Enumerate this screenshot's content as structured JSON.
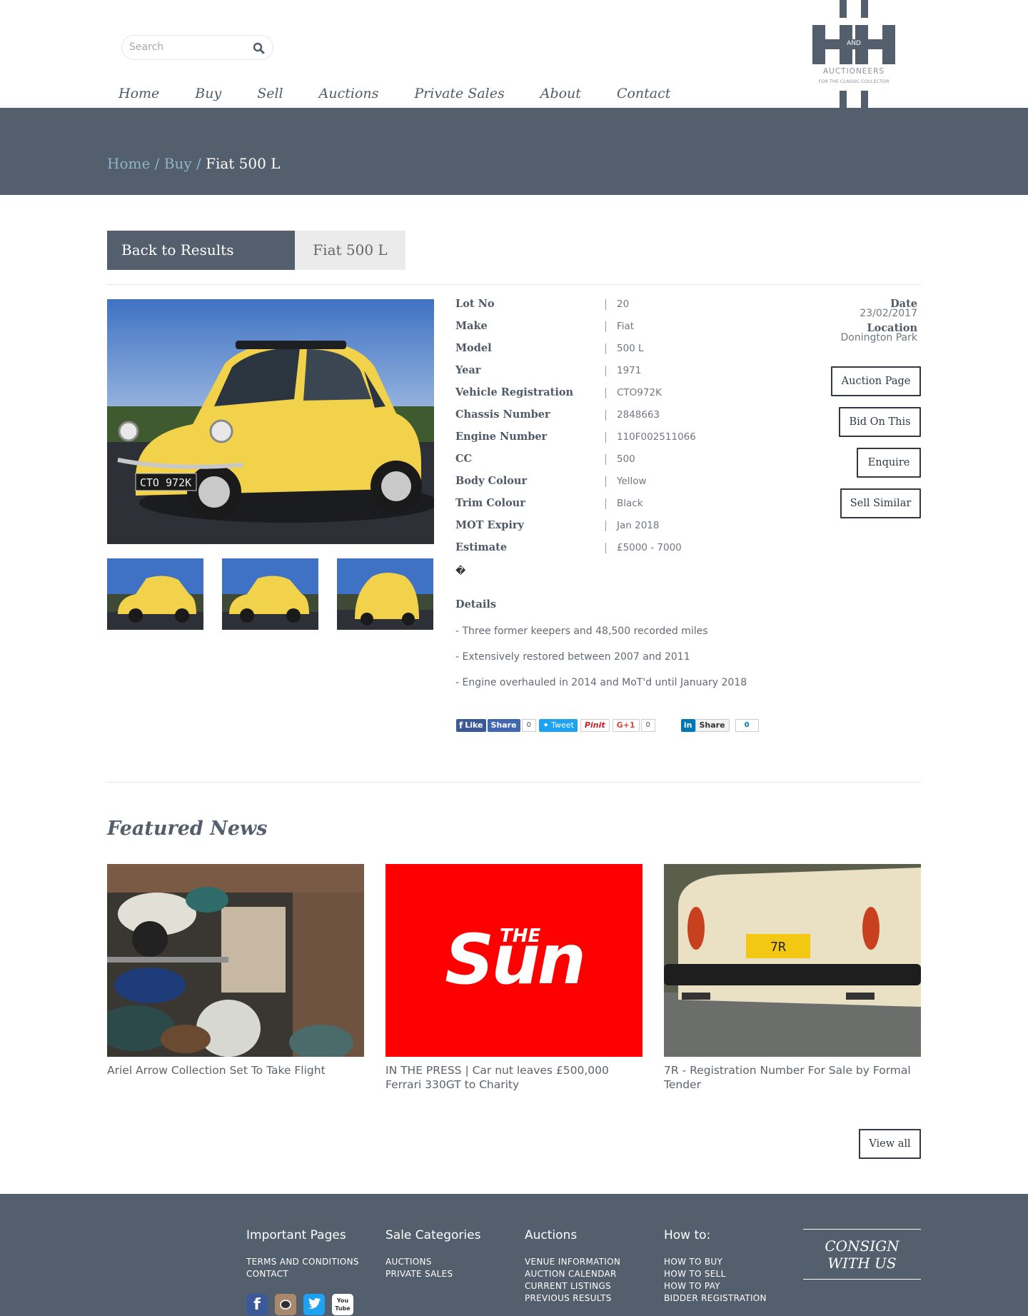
{
  "header": {
    "search_placeholder": "Search",
    "logo_and": "AND",
    "logo_line1": "AUCTIONEERS",
    "logo_line2": "FOR THE CLASSIC COLLECTOR",
    "nav": [
      "Home",
      "Buy",
      "Sell",
      "Auctions",
      "Private Sales",
      "About",
      "Contact"
    ]
  },
  "breadcrumb": {
    "home": "Home",
    "sep1": " / ",
    "buy": "Buy",
    "sep2": " / ",
    "current": "Fiat 500 L"
  },
  "tabs": {
    "back": "Back to Results",
    "current": "Fiat 500 L"
  },
  "specs": [
    {
      "label": "Lot No",
      "value": "20"
    },
    {
      "label": "Make",
      "value": "Fiat"
    },
    {
      "label": "Model",
      "value": "500 L"
    },
    {
      "label": "Year",
      "value": "1971"
    },
    {
      "label": "Vehicle Registration",
      "value": "CTO972K"
    },
    {
      "label": "Chassis Number",
      "value": "2848663"
    },
    {
      "label": "Engine Number",
      "value": "110F002511066"
    },
    {
      "label": "CC",
      "value": "500"
    },
    {
      "label": "Body Colour",
      "value": "Yellow"
    },
    {
      "label": "Trim Colour",
      "value": "Black"
    },
    {
      "label": "MOT Expiry",
      "value": "Jan 2018"
    },
    {
      "label": "Estimate",
      "value": "£5000 - 7000"
    }
  ],
  "odd_char": "�",
  "details": {
    "heading": "Details",
    "lines": [
      "- Three former keepers and 48,500 recorded miles",
      "- Extensively restored between 2007 and 2011",
      "- Engine overhauled in 2014 and MoT'd until January 2018"
    ]
  },
  "meta": {
    "date_label": "Date",
    "date_value": "23/02/2017",
    "location_label": "Location",
    "location_value": "Donington Park"
  },
  "actions": [
    "Auction Page",
    "Bid On This",
    "Enquire",
    "Sell Similar"
  ],
  "share": {
    "fb_like": "Like",
    "fb_share": "Share",
    "fb_count": "0",
    "tweet": "Tweet",
    "pin": "Pinit",
    "gplus": "G+1",
    "gplus_count": "0",
    "in_share": "Share",
    "in_count": "0"
  },
  "news": {
    "heading": "Featured News",
    "items": [
      {
        "caption": "Ariel Arrow Collection Set To Take Flight"
      },
      {
        "caption": "IN THE PRESS | Car nut leaves £500,000 Ferrari 330GT to Charity",
        "logo_top": "THE",
        "logo_main": "Sun"
      },
      {
        "caption": "7R - Registration Number For Sale by Formal Tender",
        "plate": "7R"
      }
    ],
    "view_all": "View all"
  },
  "plate_text": "CTO 972K",
  "footer": {
    "cols": [
      {
        "title": "Important Pages",
        "links": [
          "TERMS AND CONDITIONS",
          "CONTACT"
        ]
      },
      {
        "title": "Sale Categories",
        "links": [
          "AUCTIONS",
          "PRIVATE SALES"
        ]
      },
      {
        "title": "Auctions",
        "links": [
          "VENUE INFORMATION",
          "AUCTION CALENDAR",
          "CURRENT LISTINGS",
          "PREVIOUS RESULTS"
        ]
      },
      {
        "title": "How to:",
        "links": [
          "HOW TO BUY",
          "HOW TO SELL",
          "HOW TO PAY",
          "BIDDER REGISTRATION"
        ]
      }
    ],
    "consign_line1": "CONSIGN",
    "consign_line2": "WITH US",
    "social": [
      "facebook-icon",
      "instagram-icon",
      "twitter-icon",
      "youtube-icon"
    ],
    "youtube_label": "You Tube"
  },
  "colors": {
    "band": "#535f6d",
    "link": "#8fb4c8",
    "car_yellow": "#f2d24a",
    "sun_red": "#ff0000"
  }
}
